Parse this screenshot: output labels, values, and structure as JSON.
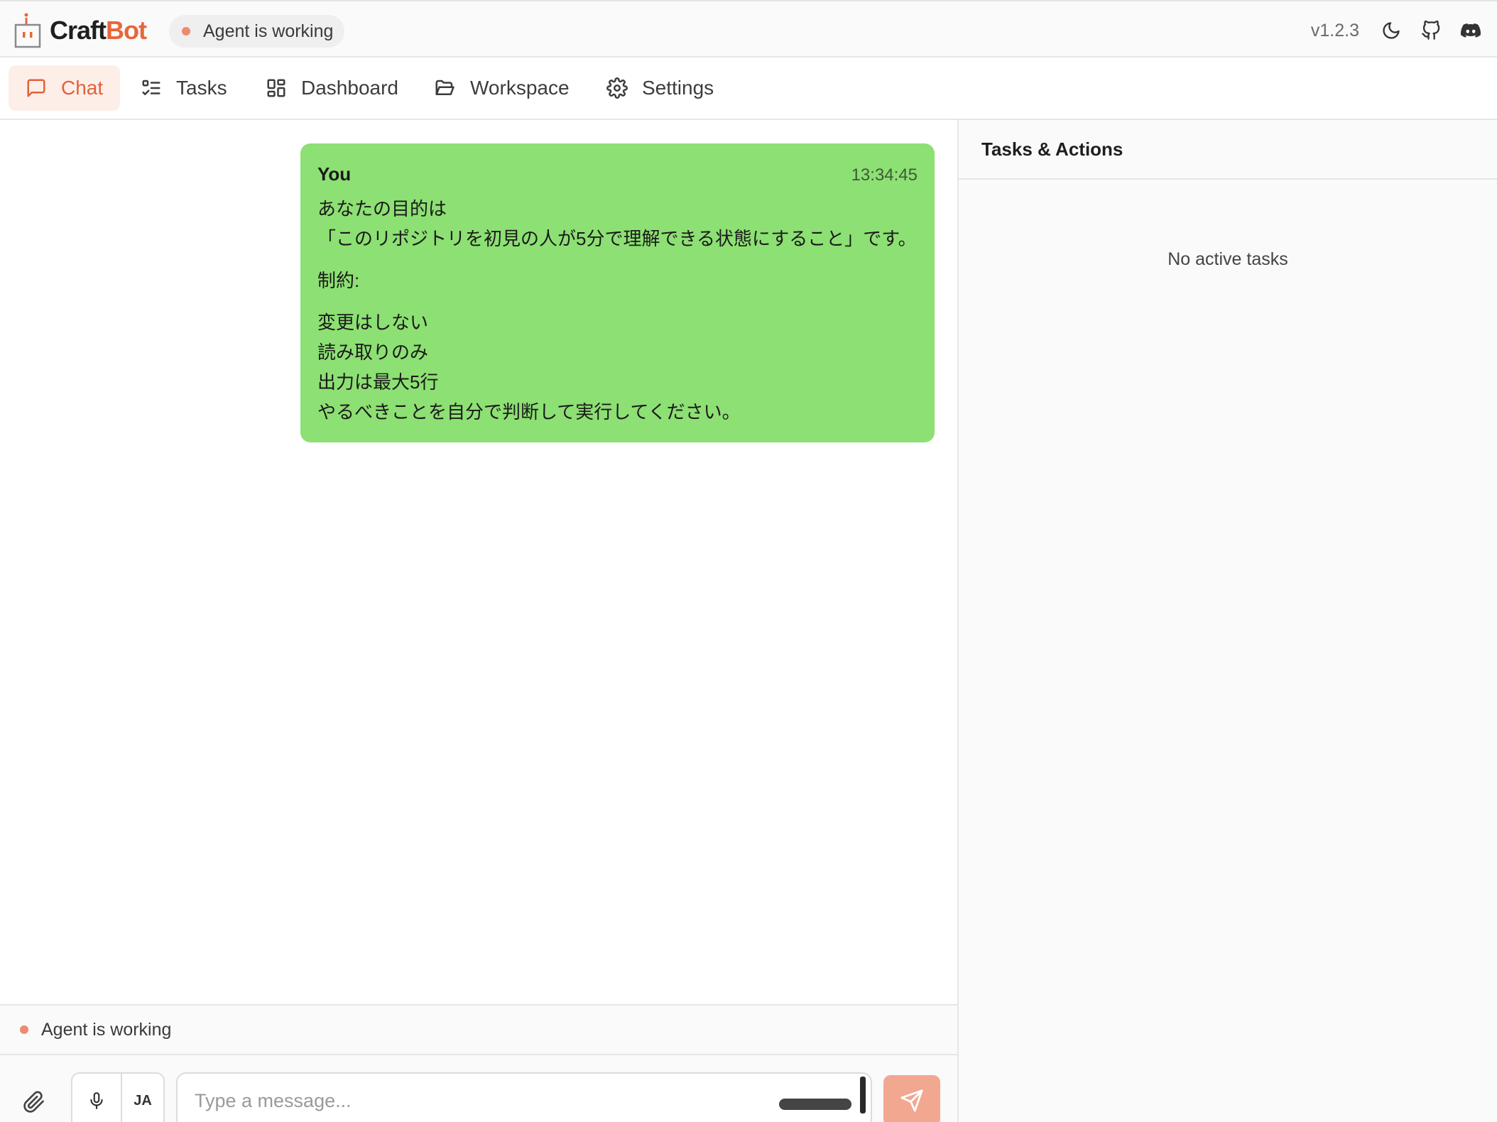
{
  "app": {
    "brand_part1": "Craft",
    "brand_part2": "Bot",
    "status": "Agent is working",
    "version": "v1.2.3",
    "accent_color": "#e8663a",
    "status_dot_color": "#ef8a70"
  },
  "topbar_icons": [
    "moon-icon",
    "github-icon",
    "discord-icon"
  ],
  "nav": {
    "tabs": [
      {
        "label": "Chat",
        "icon": "chat-bubble-icon",
        "active": true
      },
      {
        "label": "Tasks",
        "icon": "list-check-icon",
        "active": false
      },
      {
        "label": "Dashboard",
        "icon": "grid-icon",
        "active": false
      },
      {
        "label": "Workspace",
        "icon": "folder-icon",
        "active": false
      },
      {
        "label": "Settings",
        "icon": "gear-icon",
        "active": false
      }
    ]
  },
  "chat": {
    "messages": [
      {
        "sender": "You",
        "time": "13:34:45",
        "bubble_color": "#8de073",
        "lines": [
          "あなたの目的は",
          "「このリポジトリを初見の人が5分で理解できる状態にすること」です。",
          "制約:",
          "変更はしない",
          "読み取りのみ",
          "出力は最大5行",
          "やるべきことを自分で判断して実行してください。"
        ]
      }
    ]
  },
  "bottom": {
    "status": "Agent is working",
    "language": "JA",
    "input_placeholder": "Type a message...",
    "input_value": ""
  },
  "panel": {
    "title": "Tasks & Actions",
    "empty_text": "No active tasks"
  }
}
